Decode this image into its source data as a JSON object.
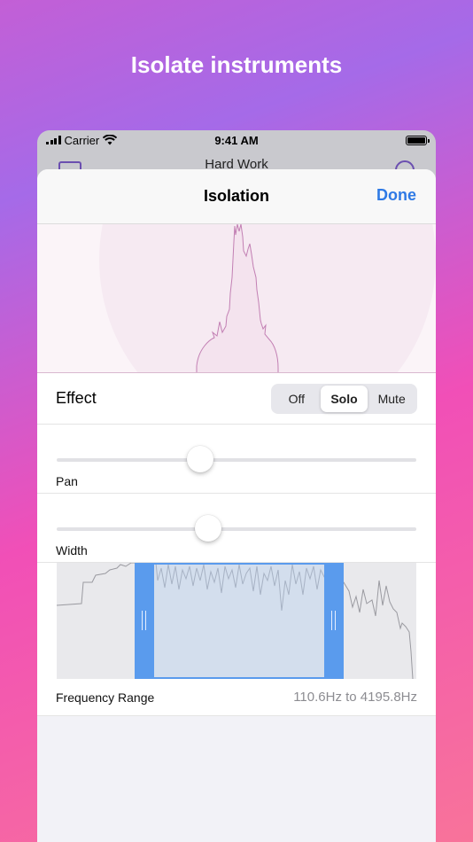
{
  "headline": "Isolate instruments",
  "status_bar": {
    "carrier": "Carrier",
    "time": "9:41 AM"
  },
  "background_screen": {
    "title": "Hard Work"
  },
  "sheet": {
    "title": "Isolation",
    "done_label": "Done",
    "effect": {
      "label": "Effect",
      "options": [
        "Off",
        "Solo",
        "Mute"
      ],
      "selected": "Solo"
    },
    "pan": {
      "label": "Pan",
      "value": 0.4
    },
    "width": {
      "label": "Width",
      "value": 0.42
    },
    "frequency_range": {
      "label": "Frequency Range",
      "value_text": "110.6Hz to 4195.8Hz"
    }
  },
  "colors": {
    "accent": "#2f7ae5",
    "selection_handle": "#5a9bed",
    "spectrum_stroke": "#c27fb3"
  },
  "icons": [
    "signal-bars-icon",
    "wifi-icon",
    "battery-icon",
    "folder-icon",
    "search-icon"
  ]
}
